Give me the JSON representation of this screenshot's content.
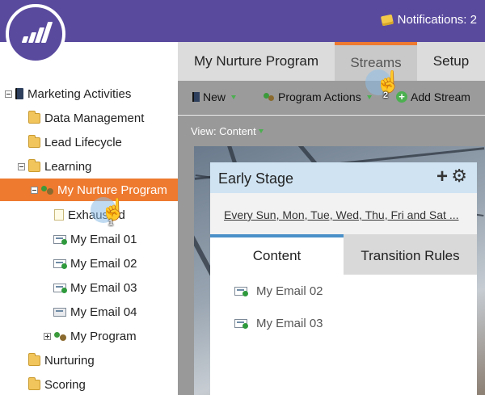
{
  "header": {
    "notifications_label": "Notifications: 2"
  },
  "sidebar": {
    "items": [
      {
        "label": "Marketing Activities"
      },
      {
        "label": "Data Management"
      },
      {
        "label": "Lead Lifecycle"
      },
      {
        "label": "Learning"
      },
      {
        "label": "My Nurture Program"
      },
      {
        "label": "Exhausted"
      },
      {
        "label": "My Email 01"
      },
      {
        "label": "My Email 02"
      },
      {
        "label": "My Email 03"
      },
      {
        "label": "My Email 04"
      },
      {
        "label": "My Program"
      },
      {
        "label": "Nurturing"
      },
      {
        "label": "Scoring"
      }
    ]
  },
  "tabs": [
    {
      "label": "My Nurture Program"
    },
    {
      "label": "Streams",
      "active": true
    },
    {
      "label": "Setup"
    }
  ],
  "toolbar": {
    "new_label": "New",
    "program_actions_label": "Program Actions",
    "add_stream_label": "Add Stream"
  },
  "view": {
    "label": "View: Content"
  },
  "stream_card": {
    "title": "Early Stage",
    "schedule": "Every Sun, Mon, Tue, Wed, Thu, Fri and Sat ...",
    "tabs": [
      {
        "label": "Content",
        "active": true
      },
      {
        "label": "Transition Rules"
      }
    ],
    "content_items": [
      {
        "label": "My Email 02"
      },
      {
        "label": "My Email 03"
      }
    ]
  },
  "cursors": [
    {
      "step": "1"
    },
    {
      "step": "2"
    }
  ],
  "colors": {
    "brand_purple": "#5a4a9e",
    "selected_orange": "#ee7a2f",
    "card_header_blue": "#cfe3f2",
    "active_tab_accent": "#4a90c8"
  }
}
